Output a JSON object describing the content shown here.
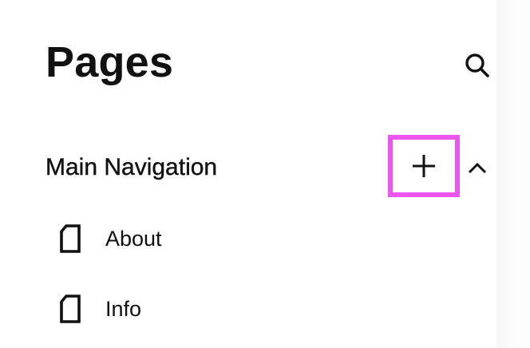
{
  "header": {
    "title": "Pages",
    "search_icon": "search-icon"
  },
  "section": {
    "title": "Main Navigation",
    "add_icon": "plus-icon",
    "collapse_icon": "chevron-up-icon",
    "highlight_color": "#ee55f0"
  },
  "pages": [
    {
      "label": "About",
      "icon": "page-icon"
    },
    {
      "label": "Info",
      "icon": "page-icon"
    }
  ]
}
